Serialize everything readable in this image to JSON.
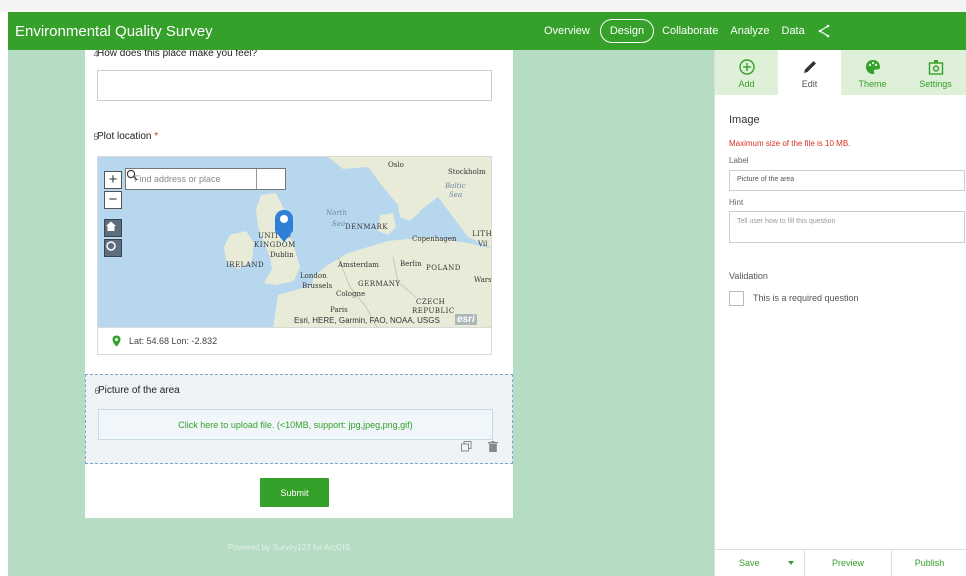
{
  "app": {
    "title": "Environmental Quality Survey"
  },
  "nav": {
    "items": [
      "Overview",
      "Design",
      "Collaborate",
      "Analyze",
      "Data"
    ],
    "active": "Design"
  },
  "colors": {
    "brand": "#35a02a",
    "canvas": "#b6dcc3",
    "required": "#d83020",
    "tab_bg": "#dff0d8"
  },
  "form": {
    "q4": {
      "number": "4",
      "label": "How does this place make you feel?"
    },
    "q5": {
      "number": "5",
      "label": "Plot location",
      "required_mark": "*",
      "map": {
        "search_placeholder": "Find address or place",
        "zoom_in": "+",
        "zoom_out": "−",
        "places": [
          "Oslo",
          "Stockholm",
          "North",
          "Sea",
          "DENMARK",
          "Copenhagen",
          "UNITED",
          "KINGDOM",
          "Dublin",
          "IRELAND",
          "London",
          "Amsterdam",
          "Berlin",
          "POLAND",
          "GERMANY",
          "Brussels",
          "Cologne",
          "Paris",
          "CZECH",
          "REPUBLIC",
          "Wars",
          "LITH",
          "Vil",
          "Baltic",
          "Sea"
        ],
        "attribution": "Esri, HERE, Garmin, FAO, NOAA, USGS",
        "esri_logo": "esri"
      },
      "latlon": "Lat: 54.68 Lon: -2.832"
    },
    "q6": {
      "number": "6",
      "label": "Picture of the area",
      "upload_text": "Click here to upload file. (<10MB, support: jpg,jpeg,png,gif)"
    },
    "submit_label": "Submit",
    "powered_by": "Powered by Survey123 for ArcGIS"
  },
  "panel": {
    "tabs": [
      {
        "label": "Add",
        "icon": "add-circle-icon"
      },
      {
        "label": "Edit",
        "icon": "pencil-icon"
      },
      {
        "label": "Theme",
        "icon": "palette-icon"
      },
      {
        "label": "Settings",
        "icon": "settings-icon"
      }
    ],
    "active_tab": "Edit",
    "heading": "Image",
    "warning": "Maximum size of the file is 10 MB.",
    "label_caption": "Label",
    "label_value": "Picture of the area",
    "hint_caption": "Hint",
    "hint_placeholder": "Tell user how to fill this question",
    "validation_caption": "Validation",
    "required_text": "This is a required question",
    "required_checked": false,
    "footer": {
      "save": "Save",
      "preview": "Preview",
      "publish": "Publish"
    }
  }
}
